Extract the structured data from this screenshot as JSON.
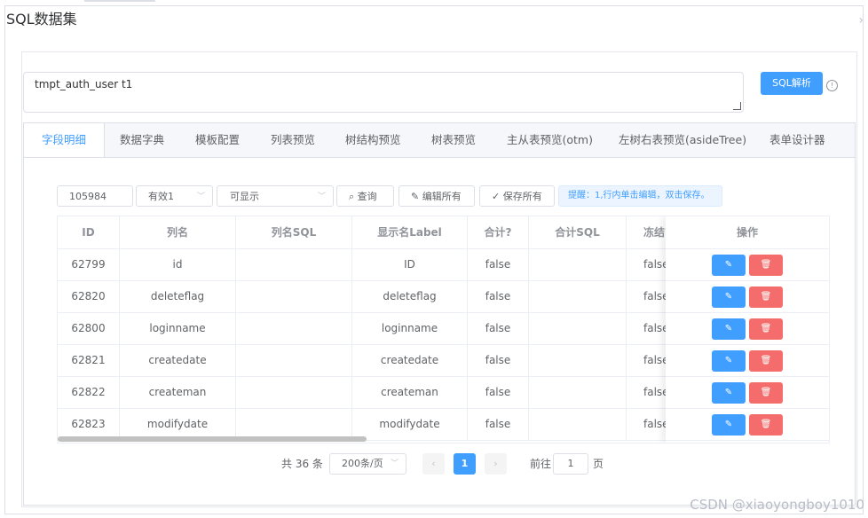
{
  "window": {
    "title": "SQL数据集"
  },
  "sql": {
    "value": "tmpt_auth_user t1",
    "parse_label": "SQL解析"
  },
  "tabs": [
    "字段明细",
    "数据字典",
    "模板配置",
    "列表预览",
    "树结构预览",
    "树表预览",
    "主从表预览(otm)",
    "左树右表预览(asideTree)",
    "表单设计器"
  ],
  "toolbar": {
    "id_value": "105984",
    "valid_value": "有效1",
    "visible_value": "可显示",
    "query_label": "查询",
    "edit_all_label": "编辑所有",
    "save_all_label": "保存所有",
    "hint": "提醒：1,行内单击编辑，双击保存。"
  },
  "table": {
    "columns": [
      "ID",
      "列名",
      "列名SQL",
      "显示名Label",
      "合计?",
      "合计SQL",
      "冻结?"
    ],
    "action_header": "操作",
    "rows": [
      {
        "id": "62799",
        "name": "id",
        "sql": "",
        "label": "ID",
        "sum": "false",
        "sumsql": "",
        "frozen": "false"
      },
      {
        "id": "62820",
        "name": "deleteflag",
        "sql": "",
        "label": "deleteflag",
        "sum": "false",
        "sumsql": "",
        "frozen": "false"
      },
      {
        "id": "62800",
        "name": "loginname",
        "sql": "",
        "label": "loginname",
        "sum": "false",
        "sumsql": "",
        "frozen": "false"
      },
      {
        "id": "62821",
        "name": "createdate",
        "sql": "",
        "label": "createdate",
        "sum": "false",
        "sumsql": "",
        "frozen": "false"
      },
      {
        "id": "62822",
        "name": "createman",
        "sql": "",
        "label": "createman",
        "sum": "false",
        "sumsql": "",
        "frozen": "false"
      },
      {
        "id": "62823",
        "name": "modifydate",
        "sql": "",
        "label": "modifydate",
        "sum": "false",
        "sumsql": "",
        "frozen": "false"
      }
    ]
  },
  "pagination": {
    "total_text": "共 36 条",
    "page_size": "200条/页",
    "current_page": "1",
    "goto_label": "前往",
    "goto_value": "1",
    "page_unit": "页"
  },
  "watermark": "CSDN @xiaoyongboy1010",
  "colors": {
    "primary": "#409eff",
    "danger": "#f56c6c"
  }
}
